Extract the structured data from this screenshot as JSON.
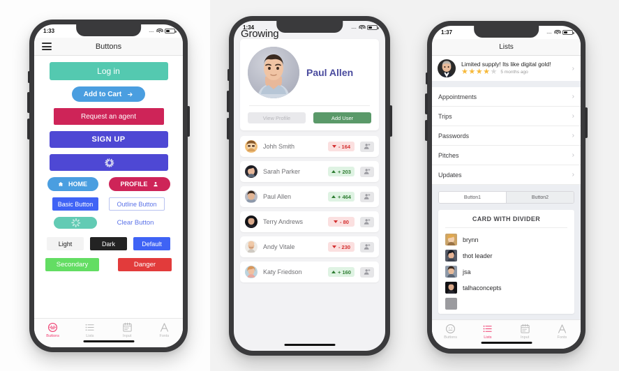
{
  "phone1": {
    "status": {
      "time": "1:33",
      "dots": "....",
      "wifi_icon": "wifi-icon",
      "battery_icon": "battery-icon"
    },
    "navbar": {
      "menu_icon": "hamburger-menu-icon",
      "title": "Buttons"
    },
    "buttons": {
      "login": "Log in",
      "add_to_cart": "Add to Cart",
      "add_to_cart_icon": "arrow-right-icon",
      "request_agent": "Request an agent",
      "sign_up": "SIGN UP",
      "loading_icon": "spinner-icon",
      "home": "HOME",
      "home_icon": "home-icon",
      "profile": "PROFILE",
      "profile_icon": "person-icon",
      "basic": "Basic Button",
      "outline": "Outline Button",
      "teal_spinner_icon": "spinner-icon",
      "clear": "Clear Button",
      "light": "Light",
      "dark": "Dark",
      "default": "Default",
      "secondary": "Secondary",
      "danger": "Danger"
    },
    "tabs": [
      {
        "label": "Buttons",
        "icon": "face-smile-icon",
        "active": true
      },
      {
        "label": "Lists",
        "icon": "list-icon",
        "active": false
      },
      {
        "label": "Input",
        "icon": "clipboard-icon",
        "active": false
      },
      {
        "label": "Fonts",
        "icon": "letter-a-icon",
        "active": false
      }
    ]
  },
  "phone2": {
    "status": {
      "time": "1:34",
      "dots": "....",
      "wifi_icon": "wifi-icon",
      "battery_icon": "battery-icon"
    },
    "title": "Growing",
    "profile_card": {
      "avatar": "avatar-paul-allen",
      "name": "Paul Allen",
      "view_profile": "View Profile",
      "add_user": "Add User"
    },
    "contacts": [
      {
        "name": "Johh Smith",
        "value": "- 164",
        "dir": "down"
      },
      {
        "name": "Sarah Parker",
        "value": "+ 203",
        "dir": "up"
      },
      {
        "name": "Paul Allen",
        "value": "+ 464",
        "dir": "up"
      },
      {
        "name": "Terry Andrews",
        "value": "- 80",
        "dir": "down"
      },
      {
        "name": "Andy Vitale",
        "value": "- 230",
        "dir": "down"
      },
      {
        "name": "Katy Friedson",
        "value": "+ 160",
        "dir": "up"
      }
    ],
    "row_action_icon": "add-person-icon"
  },
  "phone3": {
    "status": {
      "time": "1:37",
      "dots": "....",
      "wifi_icon": "wifi-icon",
      "battery_icon": "battery-icon"
    },
    "navbar": {
      "title": "Lists"
    },
    "review": {
      "avatar": "avatar-reviewer",
      "title": "Limited supply! Its like digital gold!",
      "stars_filled": 4,
      "stars_total": 5,
      "time_ago": "5 months ago",
      "chevron": "›"
    },
    "list_items": [
      {
        "label": "Appointments"
      },
      {
        "label": "Trips"
      },
      {
        "label": "Passwords"
      },
      {
        "label": "Pitches"
      },
      {
        "label": "Updates"
      }
    ],
    "segmented": [
      {
        "label": "Button1",
        "selected": true
      },
      {
        "label": "Button2",
        "selected": false
      }
    ],
    "card": {
      "title": "CARD WITH DIVIDER",
      "rows": [
        {
          "label": "brynn"
        },
        {
          "label": "thot leader"
        },
        {
          "label": "jsa"
        },
        {
          "label": "talhaconcepts"
        }
      ]
    },
    "tabs": [
      {
        "label": "Buttons",
        "icon": "face-smile-icon",
        "active": false
      },
      {
        "label": "Lists",
        "icon": "list-icon",
        "active": true
      },
      {
        "label": "Input",
        "icon": "clipboard-icon",
        "active": false
      },
      {
        "label": "Fonts",
        "icon": "letter-a-icon",
        "active": false
      }
    ]
  },
  "colors": {
    "accent_pink": "#ef3a6e",
    "teal": "#54c9b0",
    "blue": "#4a9ee0",
    "crimson": "#ce2458",
    "indigo": "#4e48d4",
    "green": "#63dd63",
    "red": "#e23b3b"
  }
}
